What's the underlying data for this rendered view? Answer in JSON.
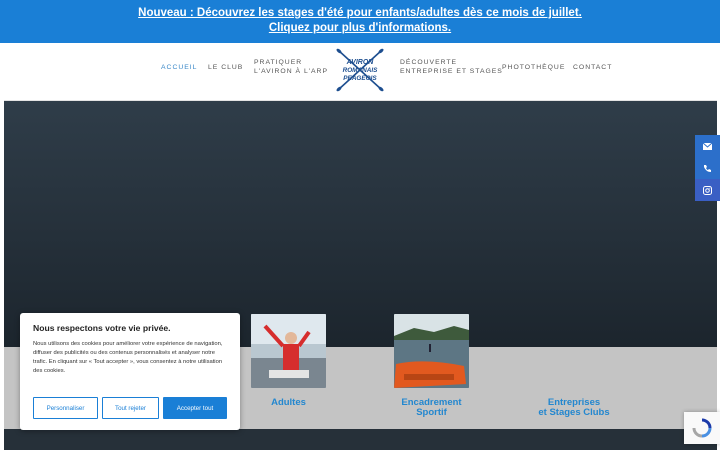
{
  "banner": {
    "line1": "Nouveau : Découvrez les stages d'été pour enfants/adultes dès ce mois de juillet.",
    "line2": "Cliquez pour plus d'informations."
  },
  "nav": {
    "accueil": "ACCUEIL",
    "le_club": "LE CLUB",
    "pratiquer_1": "PRATIQUER",
    "pratiquer_2": "L'AVIRON À L'ARP",
    "decouverte_1": "DÉCOUVERTE",
    "decouverte_2": "ENTREPRISE ET STAGES",
    "phototheque": "PHOTOTHÈQUE",
    "contact": "CONTACT"
  },
  "logo": {
    "line1": "AVIRON",
    "line2": "ROMANAIS",
    "line3": "PEAGEOIS"
  },
  "cards": [
    {
      "label": "Adultes"
    },
    {
      "label_1": "Encadrement",
      "label_2": "Sportif"
    },
    {
      "label_1": "Entreprises",
      "label_2": "et Stages Clubs"
    }
  ],
  "side_icons": [
    "envelope-icon",
    "phone-icon",
    "instagram-icon"
  ],
  "cookie": {
    "title": "Nous respectons votre vie privée.",
    "text": "Nous utilisons des cookies pour améliorer votre expérience de navigation, diffuser des publicités ou des contenus personnalisés et analyser notre trafic. En cliquant sur « Tout accepter », vous consentez à notre utilisation des cookies.",
    "customize": "Personnaliser",
    "reject": "Tout rejeter",
    "accept": "Accepter tout"
  },
  "colors": {
    "accent": "#1a7fd6",
    "link": "#2387cf",
    "side": "#2c6fca"
  }
}
